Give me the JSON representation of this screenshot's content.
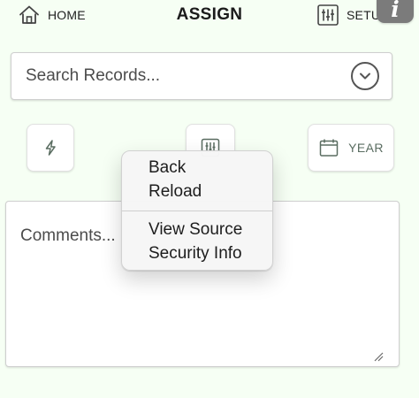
{
  "app": {
    "title": "ASSIGN"
  },
  "header": {
    "home_label": "HOME",
    "setup_label": "SETUP",
    "info_label": "i",
    "home_icon": "home-icon",
    "setup_icon": "sliders-icon",
    "info_icon": "info-icon"
  },
  "search": {
    "placeholder": "Search Records...",
    "value": "",
    "toggle_icon": "chevron-down-icon"
  },
  "toolbar": {
    "left_tile_icon": "lightning-icon",
    "middle_tile_icon": "sliders-icon",
    "year_label": "YEAR",
    "year_icon": "calendar-icon"
  },
  "comments": {
    "placeholder": "Comments...",
    "value": ""
  },
  "context_menu": {
    "items": [
      "Back",
      "Reload",
      "View Source",
      "Security Info"
    ]
  },
  "colors": {
    "background": "#f6fff4",
    "panel": "#ffffff",
    "accent": "#5a6d61",
    "menu_background": "#f6f6f6",
    "info_button": "#7b7b7b"
  }
}
